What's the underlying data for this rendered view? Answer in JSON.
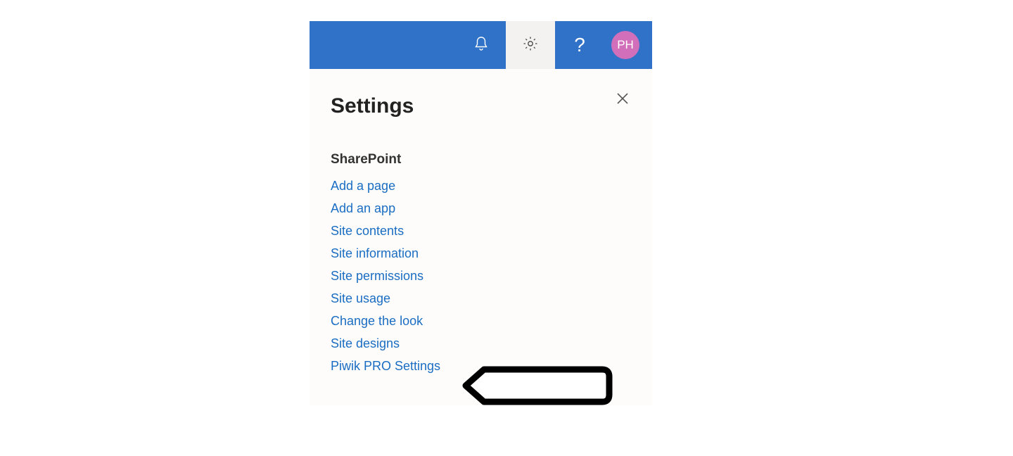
{
  "header": {
    "avatar_initials": "PH"
  },
  "panel": {
    "title": "Settings",
    "section": "SharePoint",
    "links": [
      "Add a page",
      "Add an app",
      "Site contents",
      "Site information",
      "Site permissions",
      "Site usage",
      "Change the look",
      "Site designs",
      "Piwik PRO Settings"
    ]
  }
}
